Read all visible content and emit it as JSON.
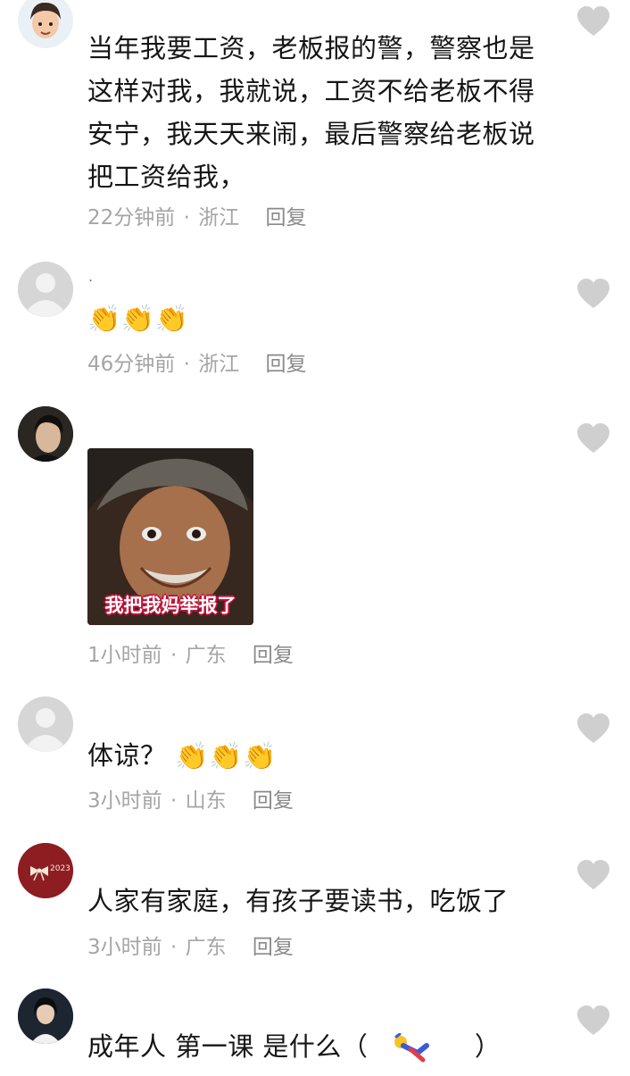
{
  "comments": [
    {
      "text": "当年我要工资，老板报的警，警察也是这样对我，我就说，工资不给老板不得安宁，我天天来闹，最后警察给老板说把工资给我，",
      "time": "22分钟前",
      "location": "浙江",
      "reply": "回复"
    },
    {
      "name": ".",
      "emoji": "👏👏👏",
      "time": "46分钟前",
      "location": "浙江",
      "reply": "回复"
    },
    {
      "meme_caption": "我把我妈举报了",
      "time": "1小时前",
      "location": "广东",
      "reply": "回复"
    },
    {
      "text": "体谅？",
      "emoji": "👏👏👏",
      "time": "3小时前",
      "location": "山东",
      "reply": "回复"
    },
    {
      "avatar_text": "2023",
      "text": "人家有家庭，有孩子要读书，吃饭了",
      "time": "3小时前",
      "location": "广东",
      "reply": "回复"
    },
    {
      "text_before": "成年人 第一课 是什么（",
      "text_after": "）"
    }
  ],
  "separator": "·",
  "icons": {
    "like": "heart-icon",
    "clap": "clapping-hands-emoji"
  },
  "colors": {
    "meta": "#a5a5a5",
    "like": "#cfcfcf"
  }
}
